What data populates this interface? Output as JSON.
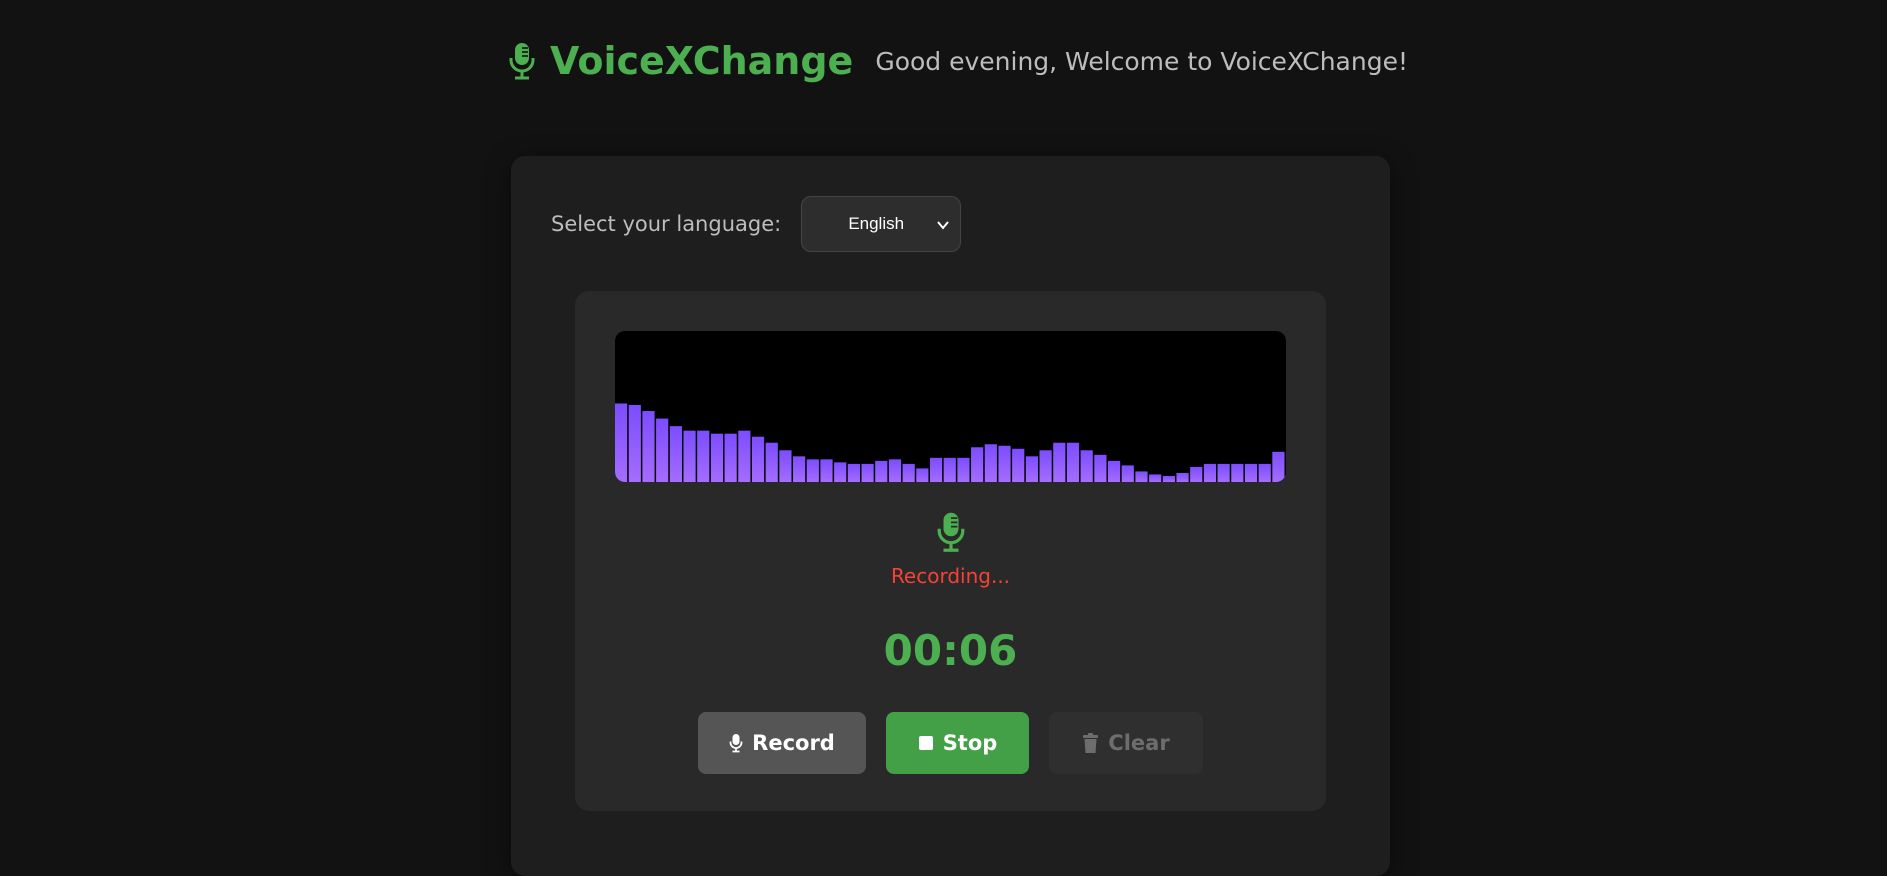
{
  "header": {
    "app_name": "VoiceXChange",
    "greeting": "Good evening, Welcome to VoiceXChange!",
    "logo_icon": "microphone-icon"
  },
  "language": {
    "label": "Select your language:",
    "selected": "English"
  },
  "recorder": {
    "status_icon": "microphone-icon",
    "status_text": "Recording...",
    "timer": "00:06",
    "visualizer_levels": [
      0.52,
      0.51,
      0.47,
      0.42,
      0.37,
      0.34,
      0.34,
      0.32,
      0.32,
      0.34,
      0.3,
      0.26,
      0.21,
      0.17,
      0.15,
      0.15,
      0.13,
      0.12,
      0.12,
      0.14,
      0.15,
      0.12,
      0.09,
      0.16,
      0.16,
      0.16,
      0.23,
      0.25,
      0.24,
      0.22,
      0.17,
      0.21,
      0.26,
      0.26,
      0.21,
      0.18,
      0.14,
      0.11,
      0.07,
      0.05,
      0.04,
      0.06,
      0.1,
      0.12,
      0.12,
      0.12,
      0.12,
      0.12,
      0.2
    ]
  },
  "buttons": {
    "record": "Record",
    "stop": "Stop",
    "clear": "Clear"
  },
  "colors": {
    "accent": "#4caf50",
    "recording": "#f44336",
    "visualizer_bar": "#8b5cf6"
  }
}
